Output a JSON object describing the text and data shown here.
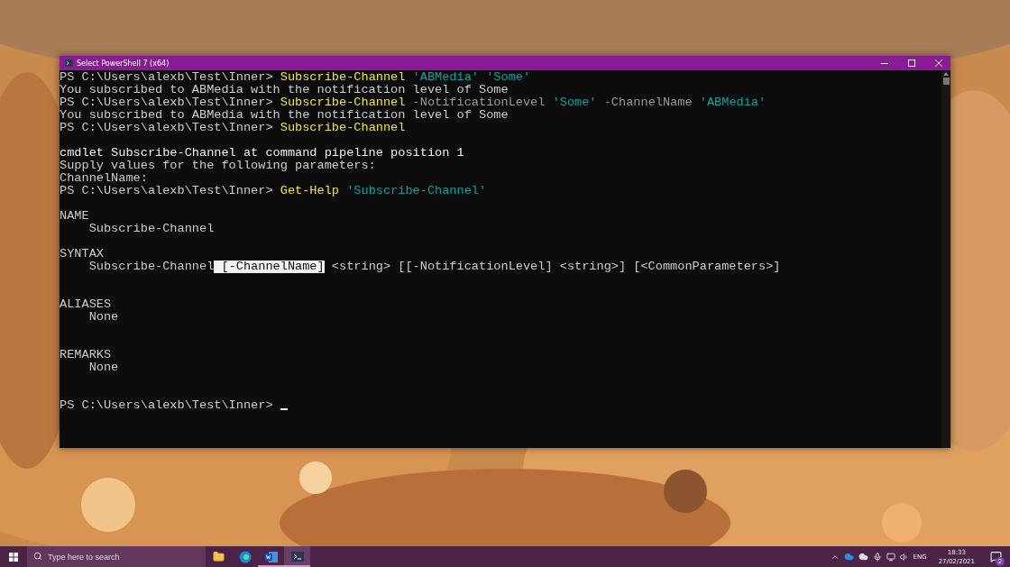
{
  "window": {
    "title": "Select PowerShell 7 (x64)"
  },
  "terminal": {
    "lines": [
      {
        "kind": "text",
        "segments": [
          {
            "kind": "output",
            "text": "PS C:\\Users\\alexb\\Test\\Inner> "
          },
          {
            "kind": "command",
            "text": "Subscribe-Channel"
          },
          {
            "kind": "string",
            "text": " 'ABMedia' 'Some'"
          }
        ]
      },
      {
        "kind": "text",
        "segments": [
          {
            "kind": "output",
            "text": "You subscribed to ABMedia with the notification level of Some"
          }
        ]
      },
      {
        "kind": "text",
        "segments": [
          {
            "kind": "output",
            "text": "PS C:\\Users\\alexb\\Test\\Inner> "
          },
          {
            "kind": "command",
            "text": "Subscribe-Channel"
          },
          {
            "kind": "param",
            "text": " -NotificationLevel "
          },
          {
            "kind": "string",
            "text": "'Some'"
          },
          {
            "kind": "param",
            "text": " -ChannelName "
          },
          {
            "kind": "string",
            "text": "'ABMedia'"
          }
        ]
      },
      {
        "kind": "text",
        "segments": [
          {
            "kind": "output",
            "text": "You subscribed to ABMedia with the notification level of Some"
          }
        ]
      },
      {
        "kind": "text",
        "segments": [
          {
            "kind": "output",
            "text": "PS C:\\Users\\alexb\\Test\\Inner> "
          },
          {
            "kind": "command",
            "text": "Subscribe-Channel"
          }
        ]
      },
      {
        "kind": "blank"
      },
      {
        "kind": "text",
        "segments": [
          {
            "kind": "bright",
            "text": "cmdlet Subscribe-Channel at command pipeline position 1"
          }
        ]
      },
      {
        "kind": "text",
        "segments": [
          {
            "kind": "output",
            "text": "Supply values for the following parameters:"
          }
        ]
      },
      {
        "kind": "text",
        "segments": [
          {
            "kind": "output",
            "text": "ChannelName:"
          }
        ]
      },
      {
        "kind": "text",
        "segments": [
          {
            "kind": "output",
            "text": "PS C:\\Users\\alexb\\Test\\Inner> "
          },
          {
            "kind": "command",
            "text": "Get-Help"
          },
          {
            "kind": "string",
            "text": " 'Subscribe-Channel'"
          }
        ]
      },
      {
        "kind": "blank"
      },
      {
        "kind": "text",
        "segments": [
          {
            "kind": "output",
            "text": "NAME"
          }
        ]
      },
      {
        "kind": "text",
        "segments": [
          {
            "kind": "output",
            "text": "    Subscribe-Channel"
          }
        ]
      },
      {
        "kind": "blank"
      },
      {
        "kind": "text",
        "segments": [
          {
            "kind": "output",
            "text": "SYNTAX"
          }
        ]
      },
      {
        "kind": "text",
        "segments": [
          {
            "kind": "output",
            "text": "    Subscribe-Channel"
          },
          {
            "kind": "selection",
            "text": " [-ChannelName]"
          },
          {
            "kind": "output",
            "text": " <string> [[-NotificationLevel] <string>] [<CommonParameters>]"
          }
        ]
      },
      {
        "kind": "blank"
      },
      {
        "kind": "blank"
      },
      {
        "kind": "text",
        "segments": [
          {
            "kind": "output",
            "text": "ALIASES"
          }
        ]
      },
      {
        "kind": "text",
        "segments": [
          {
            "kind": "output",
            "text": "    None"
          }
        ]
      },
      {
        "kind": "blank"
      },
      {
        "kind": "blank"
      },
      {
        "kind": "text",
        "segments": [
          {
            "kind": "output",
            "text": "REMARKS"
          }
        ]
      },
      {
        "kind": "text",
        "segments": [
          {
            "kind": "output",
            "text": "    None"
          }
        ]
      },
      {
        "kind": "blank"
      },
      {
        "kind": "blank"
      },
      {
        "kind": "text",
        "cursor": true,
        "segments": [
          {
            "kind": "output",
            "text": "PS C:\\Users\\alexb\\Test\\Inner> "
          }
        ]
      }
    ]
  },
  "taskbar": {
    "search": {
      "placeholder": "Type here to search"
    },
    "apps": [
      {
        "kind": "folder",
        "running": false,
        "selected": false
      },
      {
        "kind": "browser",
        "running": false,
        "selected": false
      },
      {
        "kind": "word",
        "running": true,
        "selected": false
      },
      {
        "kind": "terminal",
        "running": true,
        "selected": true
      }
    ],
    "language": "ENG",
    "time": "18:33",
    "date": "27/02/2021",
    "notifications": "2"
  }
}
